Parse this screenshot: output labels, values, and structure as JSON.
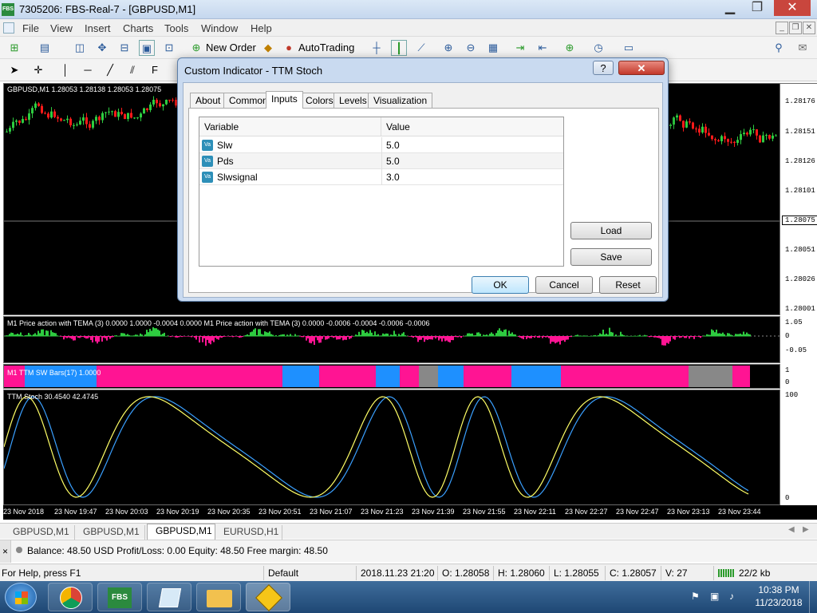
{
  "window": {
    "title": "7305206: FBS-Real-7 - [GBPUSD,M1]",
    "icon": "FBS",
    "minimize": "▁",
    "restore": "❐",
    "close": "✕"
  },
  "menu": [
    "File",
    "View",
    "Insert",
    "Charts",
    "Tools",
    "Window",
    "Help"
  ],
  "toolbar": {
    "new_order": "New Order",
    "autotrading": "AutoTrading"
  },
  "main_chart": {
    "header": "GBPUSD,M1  1.28053 1.28138 1.28053 1.28075",
    "price_labels": [
      "1.28176",
      "1.28151",
      "1.28126",
      "1.28101",
      "1.28075",
      "1.28051",
      "1.28026",
      "1.28001"
    ],
    "current_price": "1.28075"
  },
  "indicator1": {
    "label": "M1 Price action with TEMA (3) 0.0000 1.0000 -0.0004 0.0000  M1 Price action with TEMA (3) 0.0000 -0.0006 -0.0004 -0.0006 -0.0006",
    "scale": [
      "1.05",
      "0",
      "-0.05"
    ]
  },
  "indicator2": {
    "label": "M1  TTM SW Bars(17) 1.0000",
    "scale": [
      "1",
      "0"
    ]
  },
  "indicator3": {
    "label": "TTM Stoch 30.4540 42.4745",
    "scale": [
      "100",
      "0"
    ]
  },
  "time_axis": [
    "23 Nov 2018",
    "23 Nov 19:47",
    "23 Nov 20:03",
    "23 Nov 20:19",
    "23 Nov 20:35",
    "23 Nov 20:51",
    "23 Nov 21:07",
    "23 Nov 21:23",
    "23 Nov 21:39",
    "23 Nov 21:55",
    "23 Nov 22:11",
    "23 Nov 22:27",
    "23 Nov 22:47",
    "23 Nov 23:13",
    "23 Nov 23:44"
  ],
  "chart_tabs": [
    "GBPUSD,M1",
    "GBPUSD,M1",
    "GBPUSD,M1",
    "EURUSD,H1"
  ],
  "active_chart_tab": 2,
  "terminal": {
    "text": "Balance: 48.50 USD  Profit/Loss: 0.00  Equity: 48.50  Free margin: 48.50"
  },
  "statusbar": {
    "help": "For Help, press F1",
    "profile": "Default",
    "datetime": "2018.11.23 21:20",
    "open": "O: 1.28058",
    "high": "H: 1.28060",
    "low": "L: 1.28055",
    "close": "C: 1.28057",
    "volume": "V: 27",
    "traffic": "22/2 kb"
  },
  "dialog": {
    "title": "Custom Indicator - TTM Stoch",
    "help": "?",
    "close": "✕",
    "tabs": [
      "About",
      "Common",
      "Inputs",
      "Colors",
      "Levels",
      "Visualization"
    ],
    "active_tab": "Inputs",
    "grid_headers": {
      "variable": "Variable",
      "value": "Value"
    },
    "rows": [
      {
        "variable": "Slw",
        "value": "5.0"
      },
      {
        "variable": "Pds",
        "value": "5.0"
      },
      {
        "variable": "Slwsignal",
        "value": "3.0"
      }
    ],
    "buttons": {
      "load": "Load",
      "save": "Save",
      "ok": "OK",
      "cancel": "Cancel",
      "reset": "Reset"
    }
  },
  "taskbar": {
    "time": "10:38 PM",
    "date": "11/23/2018",
    "fbs_label": "FBS"
  },
  "colors": {
    "bull": "#2ecc40",
    "bear": "#ff1a1a",
    "magenta": "#ff1493",
    "blue": "#1e90ff",
    "stoch_main": "#ffff66",
    "stoch_signal": "#3aa0ff"
  }
}
